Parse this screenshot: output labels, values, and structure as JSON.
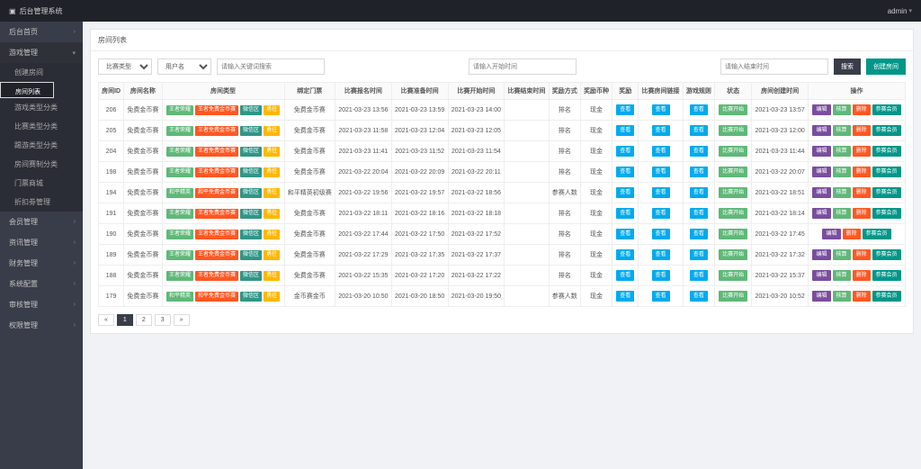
{
  "topbar": {
    "brand": "后台管理系统",
    "user": "admin"
  },
  "sidebar": {
    "items": [
      {
        "label": "后台首页",
        "expandable": true
      },
      {
        "label": "游戏管理",
        "expandable": true,
        "open": true,
        "subs": [
          {
            "label": "创建房间"
          },
          {
            "label": "房间列表",
            "sel": true
          },
          {
            "label": "游戏类型分类"
          },
          {
            "label": "比赛类型分类"
          },
          {
            "label": "踢游类型分类"
          },
          {
            "label": "房间赛制分类"
          },
          {
            "label": "门票商城"
          },
          {
            "label": "折扣劵管理"
          }
        ]
      },
      {
        "label": "会员管理",
        "expandable": true
      },
      {
        "label": "资讯管理",
        "expandable": true
      },
      {
        "label": "财务管理",
        "expandable": true
      },
      {
        "label": "系统配置",
        "expandable": true
      },
      {
        "label": "审核管理",
        "expandable": true
      },
      {
        "label": "权限管理",
        "expandable": true
      }
    ]
  },
  "panel": {
    "title": "房间列表"
  },
  "filter": {
    "type_ph": "比赛类型",
    "user_ph": "用户名",
    "kw_ph": "请输入关键词搜索",
    "start_ph": "请输入开始时间",
    "end_ph": "请输入结束时间",
    "search": "搜索",
    "create": "创建房间"
  },
  "cols": [
    "房间ID",
    "房间名称",
    "房间类型",
    "绑定门票",
    "比赛报名时间",
    "比赛准备时间",
    "比赛开始时间",
    "比赛结束时间",
    "奖励方式",
    "奖励币种",
    "奖励",
    "比赛房间链接",
    "游戏规则",
    "状态",
    "房间创建时间",
    "操作"
  ],
  "tags": {
    "wzry": "王者荣耀",
    "wzmf": "王者免费金币赛",
    "hpjy": "和平精英",
    "hpmf": "和平免费金币赛",
    "wxq": "微信区",
    "yxn": "勇往"
  },
  "btns": {
    "view": "查看",
    "start": "比赛开始",
    "edit": "编辑",
    "check": "核算",
    "del": "删除",
    "member": "参赛会员"
  },
  "rows": [
    {
      "id": 206,
      "name": "免费金币赛",
      "types": [
        "wzry",
        "wzmf",
        "wxq",
        "yxn"
      ],
      "ticket": "免费金币赛",
      "t1": "2021-03-23 13:56",
      "t2": "2021-03-23 13:59",
      "t3": "2021-03-23 14:00",
      "mode": "排名",
      "coin": "现金",
      "ct": "2021-03-23 13:57",
      "ops": [
        "edit",
        "check",
        "del",
        "member"
      ]
    },
    {
      "id": 205,
      "name": "免费金币赛",
      "types": [
        "wzry",
        "wzmf",
        "wxq",
        "yxn"
      ],
      "ticket": "免费金币赛",
      "t1": "2021-03-23 11:58",
      "t2": "2021-03-23 12:04",
      "t3": "2021-03-23 12:05",
      "mode": "排名",
      "coin": "现金",
      "ct": "2021-03-23 12:00",
      "ops": [
        "edit",
        "check",
        "del",
        "member"
      ]
    },
    {
      "id": 204,
      "name": "免费金币赛",
      "types": [
        "wzry",
        "wzmf",
        "wxq",
        "yxn"
      ],
      "ticket": "免费金币赛",
      "t1": "2021-03-23 11:41",
      "t2": "2021-03-23 11:52",
      "t3": "2021-03-23 11:54",
      "mode": "排名",
      "coin": "现金",
      "ct": "2021-03-23 11:44",
      "ops": [
        "edit",
        "check",
        "del",
        "member"
      ]
    },
    {
      "id": 198,
      "name": "免费金币赛",
      "types": [
        "wzry",
        "wzmf",
        "wxq",
        "yxn"
      ],
      "ticket": "免费金币赛",
      "t1": "2021-03-22 20:04",
      "t2": "2021-03-22 20:09",
      "t3": "2021-03-22 20:11",
      "mode": "排名",
      "coin": "现金",
      "ct": "2021-03-22 20:07",
      "ops": [
        "edit",
        "check",
        "del",
        "member"
      ]
    },
    {
      "id": 194,
      "name": "免费金币赛",
      "types": [
        "hpjy",
        "hpmf",
        "wxq",
        "yxn"
      ],
      "ticket": "和平精英初级赛",
      "t1": "2021-03-22 19:56",
      "t2": "2021-03-22 19:57",
      "t3": "2021-03-22 18:56",
      "mode": "参赛人数",
      "coin": "现金",
      "ct": "2021-03-22 18:51",
      "ops": [
        "edit",
        "check",
        "del",
        "member"
      ]
    },
    {
      "id": 191,
      "name": "免费金币赛",
      "types": [
        "wzry",
        "wzmf",
        "wxq",
        "yxn"
      ],
      "ticket": "免费金币赛",
      "t1": "2021-03-22 18:11",
      "t2": "2021-03-22 18:16",
      "t3": "2021-03-22 18:18",
      "mode": "排名",
      "coin": "现金",
      "ct": "2021-03-22 18:14",
      "ops": [
        "edit",
        "check",
        "del",
        "member"
      ]
    },
    {
      "id": 190,
      "name": "免费金币赛",
      "types": [
        "wzry",
        "wzmf",
        "wxq",
        "yxn"
      ],
      "ticket": "免费金币赛",
      "t1": "2021-03-22 17:44",
      "t2": "2021-03-22 17:50",
      "t3": "2021-03-22 17:52",
      "mode": "排名",
      "coin": "现金",
      "ct": "2021-03-22 17:45",
      "ops": [
        "edit",
        "del",
        "member"
      ]
    },
    {
      "id": 189,
      "name": "免费金币赛",
      "types": [
        "wzry",
        "wzmf",
        "wxq",
        "yxn"
      ],
      "ticket": "免费金币赛",
      "t1": "2021-03-22 17:29",
      "t2": "2021-03-22 17:35",
      "t3": "2021-03-22 17:37",
      "mode": "排名",
      "coin": "现金",
      "ct": "2021-03-22 17:32",
      "ops": [
        "edit",
        "check",
        "del",
        "member"
      ]
    },
    {
      "id": 188,
      "name": "免费金币赛",
      "types": [
        "wzry",
        "wzmf",
        "wxq",
        "yxn"
      ],
      "ticket": "免费金币赛",
      "t1": "2021-03-22 15:35",
      "t2": "2021-03-22 17:20",
      "t3": "2021-03-22 17:22",
      "mode": "排名",
      "coin": "现金",
      "ct": "2021-03-22 15:37",
      "ops": [
        "edit",
        "check",
        "del",
        "member"
      ]
    },
    {
      "id": 179,
      "name": "免费金币赛",
      "types": [
        "hpjy",
        "hpmf",
        "wxq",
        "yxn"
      ],
      "ticket": "金币赛金币",
      "t1": "2021-03-20 10:50",
      "t2": "2021-03-20 18:50",
      "t3": "2021-03-20 19:50",
      "mode": "参赛人数",
      "coin": "现金",
      "ct": "2021-03-20 10:52",
      "ops": [
        "edit",
        "check",
        "del",
        "member"
      ]
    }
  ],
  "pager": {
    "prev": "«",
    "pages": [
      "1",
      "2",
      "3"
    ],
    "next": "»",
    "current": 1
  }
}
